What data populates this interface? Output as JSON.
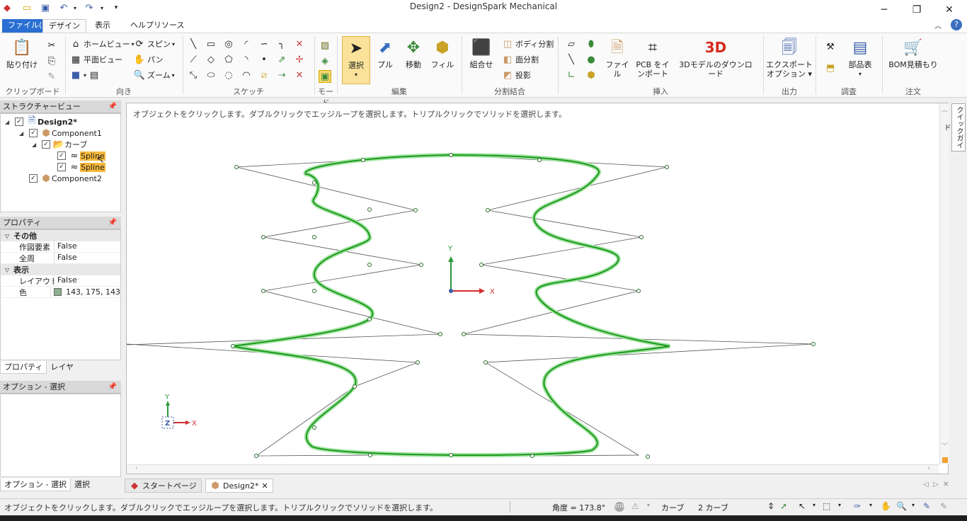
{
  "window": {
    "title": "Design2 - DesignSpark Mechanical"
  },
  "tabs": [
    "ファイル(F)",
    "デザイン",
    "表示",
    "ヘルプリソース"
  ],
  "ribbon": {
    "clipboard": {
      "paste": "貼り付け",
      "label": "クリップボード"
    },
    "orient": {
      "home_view": "ホームビュー",
      "plan_view": "平面ビュー",
      "spin": "スピン",
      "pan": "パン",
      "zoom": "ズーム",
      "label": "向き"
    },
    "sketch": {
      "label": "スケッチ"
    },
    "mode": {
      "label": "モード"
    },
    "edit": {
      "select": "選択",
      "pull": "プル",
      "move": "移動",
      "fill": "フィル",
      "label": "編集"
    },
    "intersect": {
      "combine": "組合せ",
      "split_body": "ボディ分割",
      "split_face": "面分割",
      "project": "投影",
      "label": "分割結合"
    },
    "insert": {
      "file": "ファイル",
      "pcb_line1": "PCB をイ",
      "pcb_line2": "ンポート",
      "download_3d": "3Dモデルのダウンロード",
      "icon_3d": "3D",
      "label": "挿入"
    },
    "output": {
      "export_line1": "エクスポート",
      "export_line2": "オプション",
      "label": "出力"
    },
    "inspect": {
      "bom": "部品表",
      "label": "調査"
    },
    "order": {
      "bom_quote": "BOM見積もり",
      "label": "注文"
    }
  },
  "structure": {
    "header": "ストラクチャービュー",
    "root": "Design2*",
    "component1": "Component1",
    "curves": "カーブ",
    "spline1": "Spline",
    "spline2": "Spline",
    "component2": "Component2"
  },
  "properties": {
    "header": "プロパティ",
    "cat_other": "その他",
    "construction_name": "作図要素",
    "construction_value": "False",
    "closed_name": "全周",
    "closed_value": "False",
    "cat_display": "表示",
    "layout_name": "レイアウト",
    "layout_value": "False",
    "color_name": "色",
    "color_value": "143, 175, 143",
    "color_swatch": "#8faf8f",
    "tab_properties": "プロパティ",
    "tab_layer": "レイヤ"
  },
  "options": {
    "header": "オプション - 選択",
    "tab_options": "オプション - 選択",
    "tab_select": "選択"
  },
  "viewport": {
    "hint": "オブジェクトをクリックします。ダブルクリックでエッジループを選択します。トリプルクリックでソリッドを選択します。",
    "axis_y": "Y",
    "axis_x": "X",
    "axis_z": "Z",
    "quick_guide": "クイックガイド",
    "curve_color": "#1a9a1a"
  },
  "doctabs": {
    "start": "スタートページ",
    "design": "Design2*"
  },
  "status": {
    "message": "オブジェクトをクリックします。ダブルクリックでエッジループを選択します。トリプルクリックでソリッドを選択します。",
    "angle": "角度 = 173.8°",
    "curve": "カーブ",
    "count": "2 カーブ"
  }
}
